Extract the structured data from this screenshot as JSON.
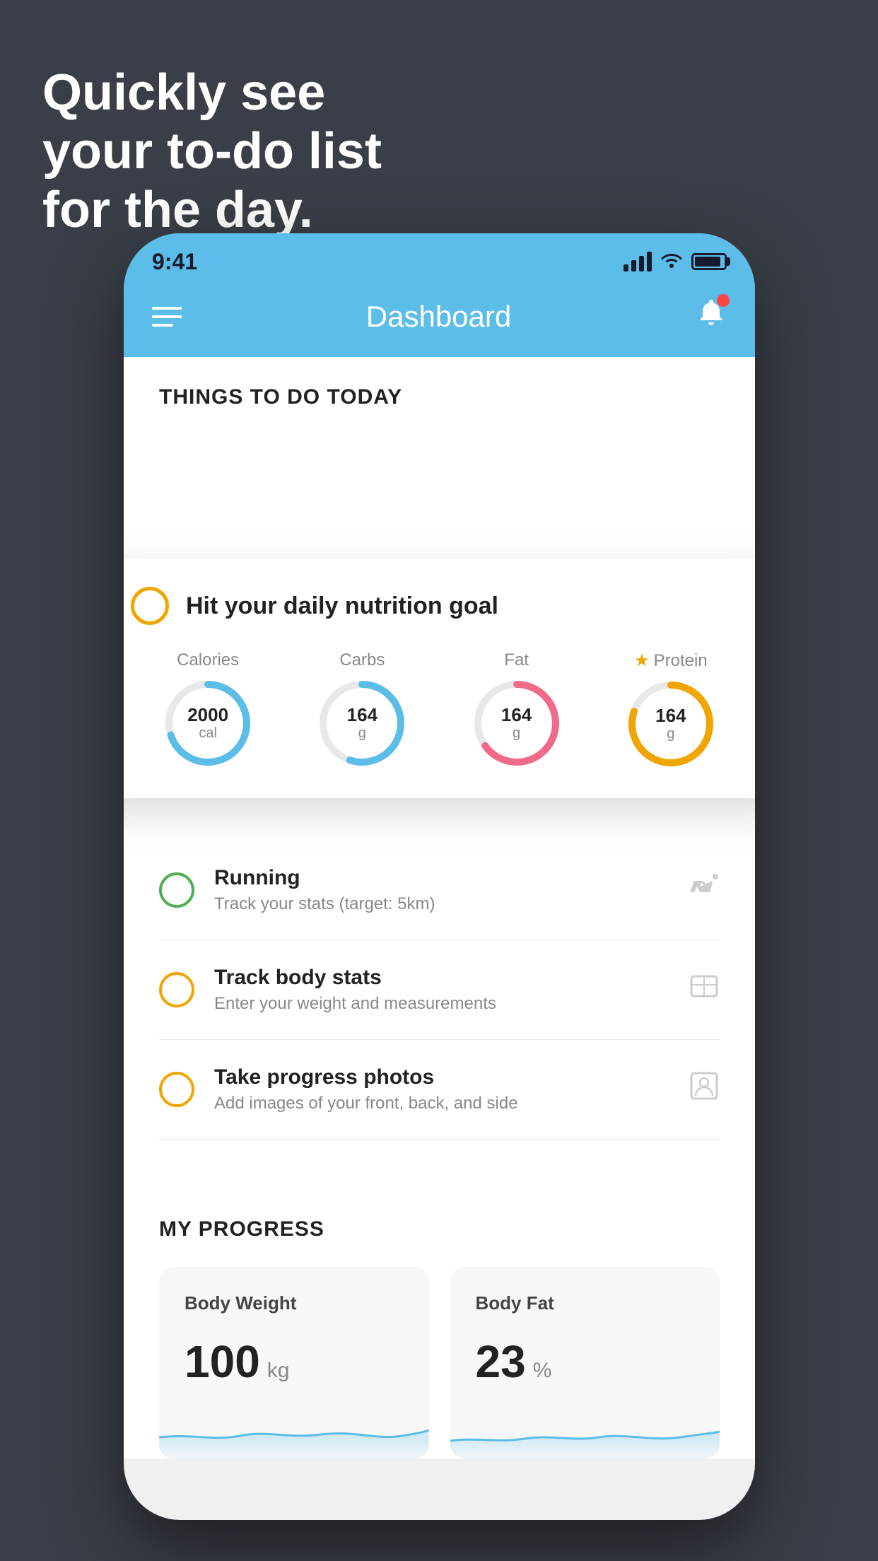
{
  "headline": {
    "line1": "Quickly see",
    "line2": "your to-do list",
    "line3": "for the day."
  },
  "statusBar": {
    "time": "9:41"
  },
  "navBar": {
    "title": "Dashboard"
  },
  "sectionHeader": {
    "title": "THINGS TO DO TODAY"
  },
  "nutritionCard": {
    "title": "Hit your daily nutrition goal",
    "items": [
      {
        "label": "Calories",
        "value": "2000",
        "unit": "cal",
        "color": "#5bbde8",
        "progress": 70
      },
      {
        "label": "Carbs",
        "value": "164",
        "unit": "g",
        "color": "#5bbde8",
        "progress": 55
      },
      {
        "label": "Fat",
        "value": "164",
        "unit": "g",
        "color": "#f06b8a",
        "progress": 65
      },
      {
        "label": "Protein",
        "value": "164",
        "unit": "g",
        "color": "#f0a500",
        "starred": true,
        "progress": 80
      }
    ]
  },
  "todoItems": [
    {
      "name": "Running",
      "desc": "Track your stats (target: 5km)",
      "circleColor": "green",
      "icon": "🏃"
    },
    {
      "name": "Track body stats",
      "desc": "Enter your weight and measurements",
      "circleColor": "yellow",
      "icon": "⚖️"
    },
    {
      "name": "Take progress photos",
      "desc": "Add images of your front, back, and side",
      "circleColor": "yellow",
      "icon": "👤"
    }
  ],
  "progressSection": {
    "title": "MY PROGRESS",
    "cards": [
      {
        "title": "Body Weight",
        "value": "100",
        "unit": "kg"
      },
      {
        "title": "Body Fat",
        "value": "23",
        "unit": "%"
      }
    ]
  }
}
